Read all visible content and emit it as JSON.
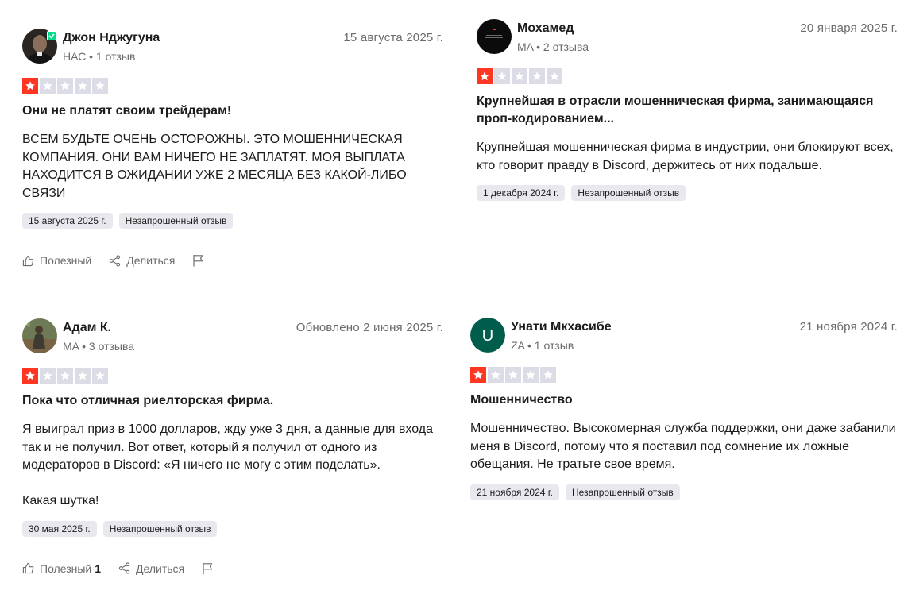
{
  "colors": {
    "star_active": "#ff3722",
    "star_inactive": "#dcdce6",
    "chip_bg": "#e8e8ee",
    "verified": "#04da8d"
  },
  "reviews": [
    {
      "name": "Джон Нджугуна",
      "meta": "НАС • 1 отзыв",
      "date": "15 августа 2025 г.",
      "rating": 1,
      "title": "Они не платят своим трейдерам!",
      "body": [
        "ВСЕМ БУДЬТЕ ОЧЕНЬ ОСТОРОЖНЫ. ЭТО МОШЕННИЧЕСКАЯ КОМПАНИЯ. ОНИ ВАМ НИЧЕГО НЕ ЗАПЛАТЯТ. МОЯ ВЫПЛАТА НАХОДИТСЯ В ОЖИДАНИИ УЖЕ 2 МЕСЯЦА БЕЗ КАКОЙ-ЛИБО СВЯЗИ"
      ],
      "experience_date": "15 августа 2025 г.",
      "tag": "Незапрошенный отзыв",
      "helpful_label": "Полезный",
      "helpful_count": "",
      "share_label": "Делиться",
      "avatar_icon": "photo-avatar-icon"
    },
    {
      "name": "Мохамед",
      "meta": "MA • 2 отзыва",
      "date": "20 января 2025 г.",
      "rating": 1,
      "title": "Крупнейшая в отрасли мошенническая фирма, занимающаяся проп-кодированием...",
      "body": [
        "Крупнейшая мошенническая фирма в индустрии, они блокируют всех, кто говорит правду в Discord, держитесь от них подальше."
      ],
      "experience_date": "1 декабря 2024 г.",
      "tag": "Незапрошенный отзыв",
      "avatar_icon": "dark-avatar-icon"
    },
    {
      "name": "Адам К.",
      "meta": "MA • 3 отзыва",
      "date": "Обновлено 2 июня 2025 г.",
      "rating": 1,
      "title": "Пока что отличная риелторская фирма.",
      "body": [
        "Я выиграл приз в 1000 долларов, жду уже 3 дня, а данные для входа так и не получил. Вот ответ, который я получил от одного из модераторов в Discord: «Я ничего не могу с этим поделать».",
        "Какая шутка!"
      ],
      "experience_date": "30 мая 2025 г.",
      "tag": "Незапрошенный отзыв",
      "helpful_label": "Полезный",
      "helpful_count": "1",
      "share_label": "Делиться",
      "avatar_icon": "photo-avatar-icon"
    },
    {
      "name": "Унати Мкхасибе",
      "meta": "ZA • 1 отзыв",
      "date": "21 ноября 2024 г.",
      "rating": 1,
      "title": "Мошенничество",
      "body": [
        "Мошенничество. Высокомерная служба поддержки, они даже забанили меня в Discord, потому что я поставил под сомнение их ложные обещания. Не тратьте свое время."
      ],
      "experience_date": "21 ноября 2024 г.",
      "tag": "Незапрошенный отзыв",
      "avatar_initial": "U",
      "avatar_color": "#005c4b",
      "avatar_icon": "initial-avatar-icon"
    }
  ]
}
